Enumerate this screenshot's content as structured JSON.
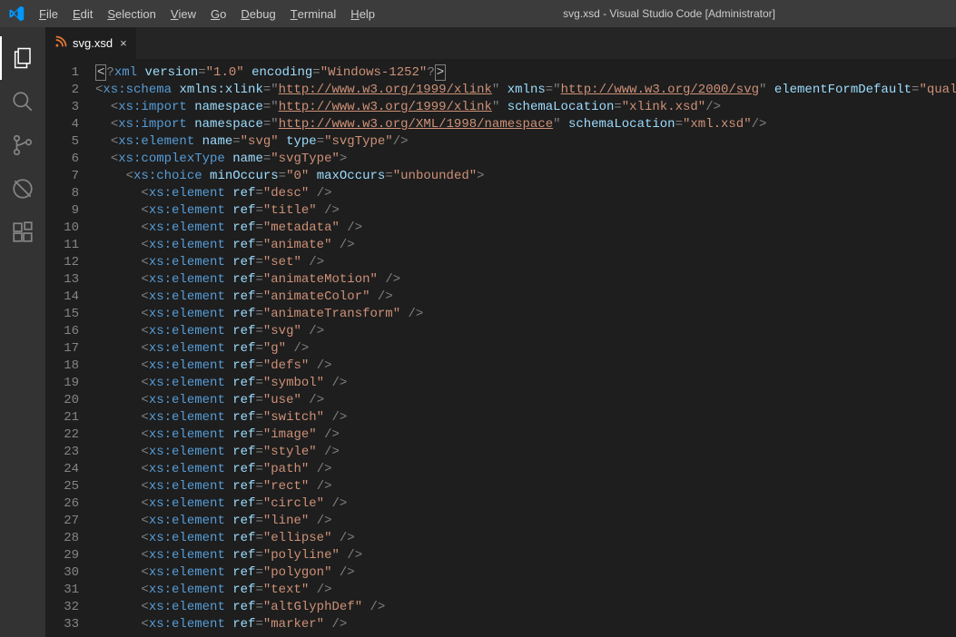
{
  "titlebar": {
    "center_text": "svg.xsd - Visual Studio Code [Administrator]"
  },
  "menu": {
    "items": [
      {
        "hotkey": "F",
        "rest": "ile"
      },
      {
        "hotkey": "E",
        "rest": "dit"
      },
      {
        "hotkey": "S",
        "rest": "election"
      },
      {
        "hotkey": "V",
        "rest": "iew"
      },
      {
        "hotkey": "G",
        "rest": "o"
      },
      {
        "hotkey": "D",
        "rest": "ebug"
      },
      {
        "hotkey": "T",
        "rest": "erminal"
      },
      {
        "hotkey": "H",
        "rest": "elp"
      }
    ]
  },
  "activity_bar": {
    "icons": [
      "files-icon",
      "search-icon",
      "source-control-icon",
      "debug-icon",
      "extensions-icon"
    ]
  },
  "tab": {
    "filename": "svg.xsd",
    "close_glyph": "×"
  },
  "code": {
    "lines": [
      {
        "n": 1,
        "tokens": [
          {
            "c": "cursor-box",
            "t": "<"
          },
          {
            "c": "t-grey",
            "t": "?"
          },
          {
            "c": "t-tag",
            "t": "xml"
          },
          {
            "c": "",
            "t": " "
          },
          {
            "c": "t-attr",
            "t": "version"
          },
          {
            "c": "t-grey",
            "t": "="
          },
          {
            "c": "t-str",
            "t": "\"1.0\""
          },
          {
            "c": "",
            "t": " "
          },
          {
            "c": "t-attr",
            "t": "encoding"
          },
          {
            "c": "t-grey",
            "t": "="
          },
          {
            "c": "t-str",
            "t": "\"Windows-1252\""
          },
          {
            "c": "t-grey",
            "t": "?"
          },
          {
            "c": "cursor-box",
            "t": ">"
          }
        ]
      },
      {
        "n": 2,
        "tokens": [
          {
            "c": "t-grey",
            "t": "<"
          },
          {
            "c": "t-tag",
            "t": "xs:schema"
          },
          {
            "c": "",
            "t": " "
          },
          {
            "c": "t-attr",
            "t": "xmlns:xlink"
          },
          {
            "c": "t-grey",
            "t": "=\""
          },
          {
            "c": "t-link",
            "t": "http://www.w3.org/1999/xlink"
          },
          {
            "c": "t-grey",
            "t": "\""
          },
          {
            "c": "",
            "t": " "
          },
          {
            "c": "t-attr",
            "t": "xmlns"
          },
          {
            "c": "t-grey",
            "t": "=\""
          },
          {
            "c": "t-link",
            "t": "http://www.w3.org/2000/svg"
          },
          {
            "c": "t-grey",
            "t": "\""
          },
          {
            "c": "",
            "t": " "
          },
          {
            "c": "t-attr",
            "t": "elementFormDefault"
          },
          {
            "c": "t-grey",
            "t": "="
          },
          {
            "c": "t-str",
            "t": "\"qualified\""
          }
        ]
      },
      {
        "n": 3,
        "tokens": [
          {
            "c": "",
            "t": "  "
          },
          {
            "c": "t-grey",
            "t": "<"
          },
          {
            "c": "t-tag",
            "t": "xs:import"
          },
          {
            "c": "",
            "t": " "
          },
          {
            "c": "t-attr",
            "t": "namespace"
          },
          {
            "c": "t-grey",
            "t": "=\""
          },
          {
            "c": "t-link",
            "t": "http://www.w3.org/1999/xlink"
          },
          {
            "c": "t-grey",
            "t": "\""
          },
          {
            "c": "",
            "t": " "
          },
          {
            "c": "t-attr",
            "t": "schemaLocation"
          },
          {
            "c": "t-grey",
            "t": "="
          },
          {
            "c": "t-str",
            "t": "\"xlink.xsd\""
          },
          {
            "c": "t-grey",
            "t": "/>"
          }
        ]
      },
      {
        "n": 4,
        "tokens": [
          {
            "c": "",
            "t": "  "
          },
          {
            "c": "t-grey",
            "t": "<"
          },
          {
            "c": "t-tag",
            "t": "xs:import"
          },
          {
            "c": "",
            "t": " "
          },
          {
            "c": "t-attr",
            "t": "namespace"
          },
          {
            "c": "t-grey",
            "t": "=\""
          },
          {
            "c": "t-link",
            "t": "http://www.w3.org/XML/1998/namespace"
          },
          {
            "c": "t-grey",
            "t": "\""
          },
          {
            "c": "",
            "t": " "
          },
          {
            "c": "t-attr",
            "t": "schemaLocation"
          },
          {
            "c": "t-grey",
            "t": "="
          },
          {
            "c": "t-str",
            "t": "\"xml.xsd\""
          },
          {
            "c": "t-grey",
            "t": "/>"
          }
        ]
      },
      {
        "n": 5,
        "tokens": [
          {
            "c": "",
            "t": "  "
          },
          {
            "c": "t-grey",
            "t": "<"
          },
          {
            "c": "t-tag",
            "t": "xs:element"
          },
          {
            "c": "",
            "t": " "
          },
          {
            "c": "t-attr",
            "t": "name"
          },
          {
            "c": "t-grey",
            "t": "="
          },
          {
            "c": "t-str",
            "t": "\"svg\""
          },
          {
            "c": "",
            "t": " "
          },
          {
            "c": "t-attr",
            "t": "type"
          },
          {
            "c": "t-grey",
            "t": "="
          },
          {
            "c": "t-str",
            "t": "\"svgType\""
          },
          {
            "c": "t-grey",
            "t": "/>"
          }
        ]
      },
      {
        "n": 6,
        "tokens": [
          {
            "c": "",
            "t": "  "
          },
          {
            "c": "t-grey",
            "t": "<"
          },
          {
            "c": "t-tag",
            "t": "xs:complexType"
          },
          {
            "c": "",
            "t": " "
          },
          {
            "c": "t-attr",
            "t": "name"
          },
          {
            "c": "t-grey",
            "t": "="
          },
          {
            "c": "t-str",
            "t": "\"svgType\""
          },
          {
            "c": "t-grey",
            "t": ">"
          }
        ]
      },
      {
        "n": 7,
        "tokens": [
          {
            "c": "",
            "t": "    "
          },
          {
            "c": "t-grey",
            "t": "<"
          },
          {
            "c": "t-tag",
            "t": "xs:choice"
          },
          {
            "c": "",
            "t": " "
          },
          {
            "c": "t-attr",
            "t": "minOccurs"
          },
          {
            "c": "t-grey",
            "t": "="
          },
          {
            "c": "t-str",
            "t": "\"0\""
          },
          {
            "c": "",
            "t": " "
          },
          {
            "c": "t-attr",
            "t": "maxOccurs"
          },
          {
            "c": "t-grey",
            "t": "="
          },
          {
            "c": "t-str",
            "t": "\"unbounded\""
          },
          {
            "c": "t-grey",
            "t": ">"
          }
        ]
      },
      {
        "n": 8,
        "ref": "desc"
      },
      {
        "n": 9,
        "ref": "title"
      },
      {
        "n": 10,
        "ref": "metadata"
      },
      {
        "n": 11,
        "ref": "animate"
      },
      {
        "n": 12,
        "ref": "set"
      },
      {
        "n": 13,
        "ref": "animateMotion"
      },
      {
        "n": 14,
        "ref": "animateColor"
      },
      {
        "n": 15,
        "ref": "animateTransform"
      },
      {
        "n": 16,
        "ref": "svg"
      },
      {
        "n": 17,
        "ref": "g"
      },
      {
        "n": 18,
        "ref": "defs"
      },
      {
        "n": 19,
        "ref": "symbol"
      },
      {
        "n": 20,
        "ref": "use"
      },
      {
        "n": 21,
        "ref": "switch"
      },
      {
        "n": 22,
        "ref": "image"
      },
      {
        "n": 23,
        "ref": "style"
      },
      {
        "n": 24,
        "ref": "path"
      },
      {
        "n": 25,
        "ref": "rect"
      },
      {
        "n": 26,
        "ref": "circle"
      },
      {
        "n": 27,
        "ref": "line"
      },
      {
        "n": 28,
        "ref": "ellipse"
      },
      {
        "n": 29,
        "ref": "polyline"
      },
      {
        "n": 30,
        "ref": "polygon"
      },
      {
        "n": 31,
        "ref": "text"
      },
      {
        "n": 32,
        "ref": "altGlyphDef"
      },
      {
        "n": 33,
        "ref": "marker"
      }
    ]
  }
}
